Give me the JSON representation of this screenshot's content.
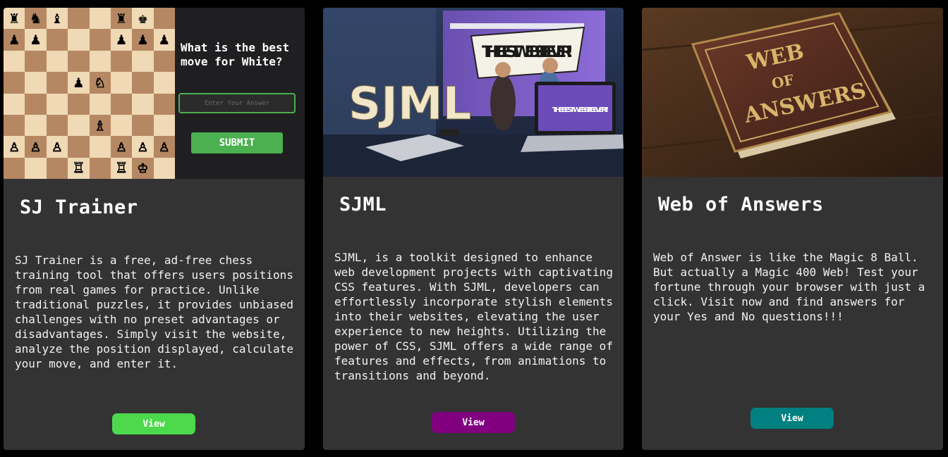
{
  "cards": [
    {
      "title": "SJ Trainer",
      "description": "SJ Trainer is a free, ad-free chess training tool that offers users positions from real games for practice. Unlike traditional puzzles, it provides unbiased challenges with no preset advantages or disadvantages. Simply visit the website, analyze the position displayed, calculate your move, and enter it.",
      "button_label": "View",
      "button_color": "#4cd94c",
      "preview": {
        "question": "What is the best move for White?",
        "input_placeholder": "Enter Your Answer",
        "submit_label": "SUBMIT",
        "board": [
          [
            "♜",
            "♞",
            "♝",
            "",
            "",
            "♜",
            "♚",
            ""
          ],
          [
            "♟",
            "♟",
            "",
            "",
            "",
            "♟",
            "♟",
            "♟"
          ],
          [
            "",
            "",
            "",
            "",
            "",
            "",
            "",
            ""
          ],
          [
            "",
            "",
            "",
            "♟",
            "♘",
            "",
            "",
            ""
          ],
          [
            "",
            "",
            "",
            "",
            "",
            "",
            "",
            ""
          ],
          [
            "",
            "",
            "",
            "",
            "♗",
            "",
            "",
            ""
          ],
          [
            "♙",
            "♙",
            "♙",
            "",
            "",
            "♙",
            "♙",
            "♙"
          ],
          [
            "",
            "",
            "",
            "♖",
            "",
            "♖",
            "♔",
            ""
          ]
        ]
      }
    },
    {
      "title": "SJML",
      "description": "SJML, is a toolkit designed to enhance web development projects with captivating CSS features. With SJML, developers can effortlessly incorporate stylish elements into their websites, elevating the user experience to new heights. Utilizing the power of CSS, SJML offers a wide range of features and effects, from animations to transitions and beyond.",
      "button_label": "View",
      "button_color": "#800080",
      "preview": {
        "logo_text": "SJML",
        "banner_text": "THE BEST WEBSITE EVER!!",
        "screen_text": "THE BEST WEBSITE EVER!!"
      }
    },
    {
      "title": "Web of Answers",
      "description": "Web of Answer is like the Magic 8 Ball. But actually a Magic 400 Web! Test your fortune through your browser with just a click. Visit now and find answers for your Yes and No questions!!!",
      "button_label": "View",
      "button_color": "#008080",
      "preview": {
        "book_line1": "WEB",
        "book_line2": "OF",
        "book_line3": "ANSWERS"
      }
    }
  ]
}
